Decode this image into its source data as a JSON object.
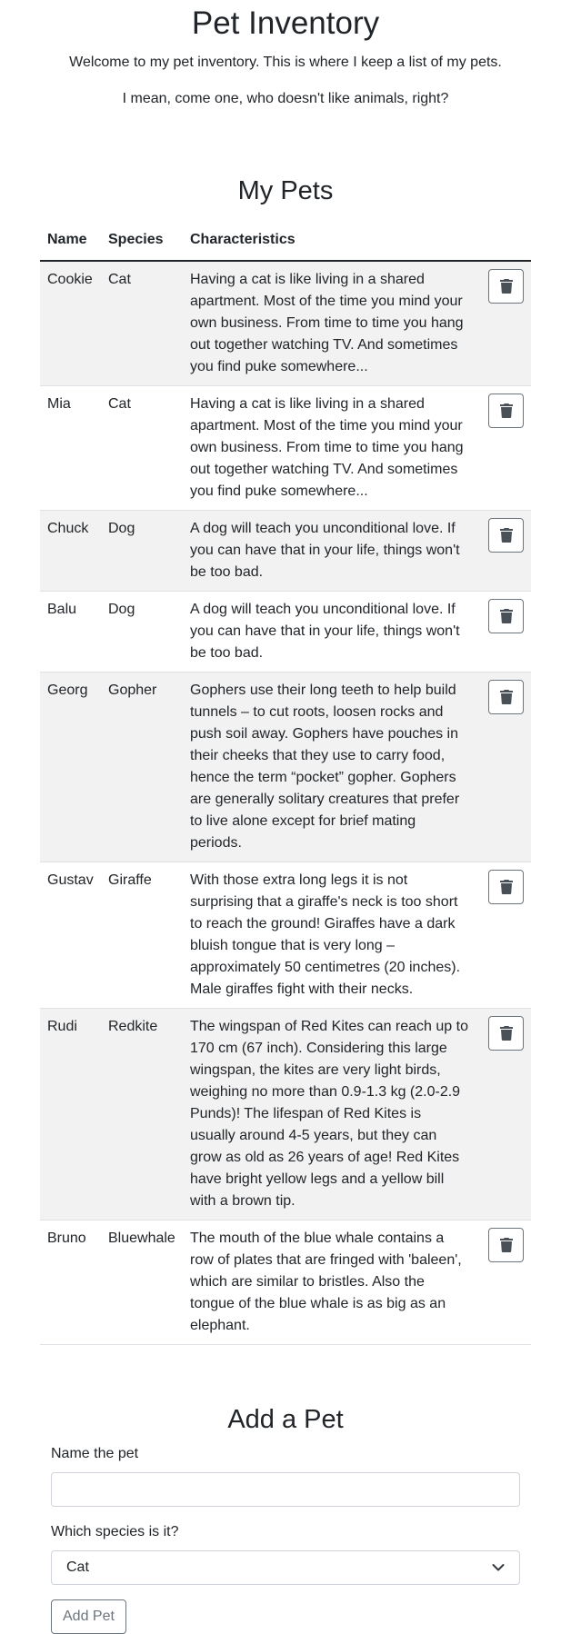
{
  "header": {
    "title": "Pet Inventory",
    "intro_1": "Welcome to my pet inventory. This is where I keep a list of my pets.",
    "intro_2": "I mean, come one, who doesn't like animals, right?"
  },
  "pets_section": {
    "title": "My Pets",
    "columns": [
      "Name",
      "Species",
      "Characteristics"
    ],
    "rows": [
      {
        "name": "Cookie",
        "species": "Cat",
        "characteristics": "Having a cat is like living in a shared apartment. Most of the time you mind your own business. From time to time you hang out together watching TV. And sometimes you find puke somewhere..."
      },
      {
        "name": "Mia",
        "species": "Cat",
        "characteristics": "Having a cat is like living in a shared apartment. Most of the time you mind your own business. From time to time you hang out together watching TV. And sometimes you find puke somewhere..."
      },
      {
        "name": "Chuck",
        "species": "Dog",
        "characteristics": "A dog will teach you unconditional love. If you can have that in your life, things won't be too bad."
      },
      {
        "name": "Balu",
        "species": "Dog",
        "characteristics": "A dog will teach you unconditional love. If you can have that in your life, things won't be too bad."
      },
      {
        "name": "Georg",
        "species": "Gopher",
        "characteristics": "Gophers use their long teeth to help build tunnels – to cut roots, loosen rocks and push soil away. Gophers have pouches in their cheeks that they use to carry food, hence the term “pocket” gopher. Gophers are generally solitary creatures that prefer to live alone except for brief mating periods."
      },
      {
        "name": "Gustav",
        "species": "Giraffe",
        "characteristics": "With those extra long legs it is not surprising that a giraffe's neck is too short to reach the ground! Giraffes have a dark bluish tongue that is very long – approximately 50 centimetres (20 inches). Male giraffes fight with their necks."
      },
      {
        "name": "Rudi",
        "species": "Redkite",
        "characteristics": "The wingspan of Red Kites can reach up to 170 cm (67 inch). Considering this large wingspan, the kites are very light birds, weighing no more than 0.9-1.3 kg (2.0-2.9 Punds)! The lifespan of Red Kites is usually around 4-5 years, but they can grow as old as 26 years of age! Red Kites have bright yellow legs and a yellow bill with a brown tip."
      },
      {
        "name": "Bruno",
        "species": "Bluewhale",
        "characteristics": "The mouth of the blue whale contains a row of plates that are fringed with 'baleen', which are similar to bristles. Also the tongue of the blue whale is as big as an elephant."
      }
    ],
    "delete_icon": "trash-icon"
  },
  "add_section": {
    "title": "Add a Pet",
    "name_label": "Name the pet",
    "name_value": "",
    "name_placeholder": "",
    "species_label": "Which species is it?",
    "species_selected": "Cat",
    "submit_label": "Add Pet"
  },
  "colors": {
    "text": "#212529",
    "stripe": "#f2f2f2",
    "border": "#dee2e6",
    "button_outline": "#6c757d"
  }
}
